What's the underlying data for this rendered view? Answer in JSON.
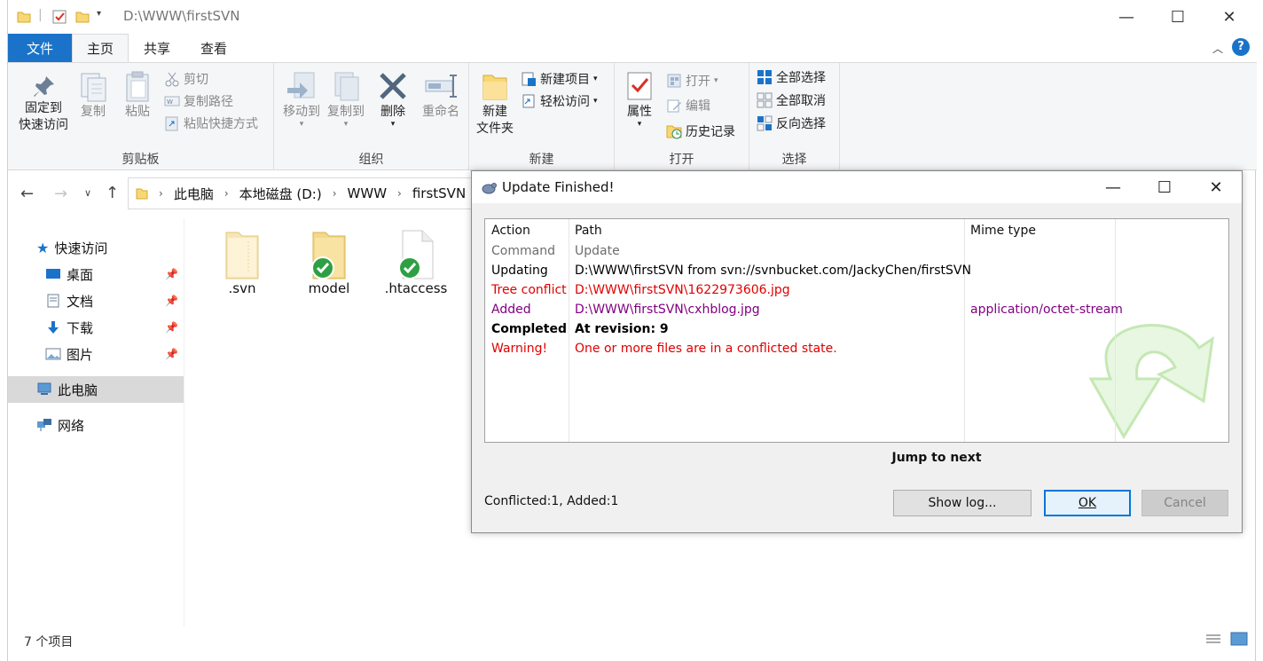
{
  "window": {
    "title": "D:\\WWW\\firstSVN"
  },
  "ribbon_tabs": [
    {
      "label": "文件"
    },
    {
      "label": "主页"
    },
    {
      "label": "共享"
    },
    {
      "label": "查看"
    }
  ],
  "ribbon": {
    "clipboard": {
      "label": "剪贴板",
      "pin": "固定到\n快速访问",
      "pin1": "固定到",
      "pin2": "快速访问",
      "copy": "复制",
      "paste": "粘贴",
      "cut": "剪切",
      "copy_path": "复制路径",
      "paste_shortcut": "粘贴快捷方式"
    },
    "organize": {
      "label": "组织",
      "move_to": "移动到",
      "copy_to": "复制到",
      "delete": "删除",
      "rename": "重命名"
    },
    "new": {
      "label": "新建",
      "new_folder1": "新建",
      "new_folder2": "文件夹",
      "new_item": "新建项目",
      "easy_access": "轻松访问"
    },
    "open": {
      "label": "打开",
      "properties": "属性",
      "open": "打开",
      "edit": "编辑",
      "history": "历史记录"
    },
    "select": {
      "label": "选择",
      "select_all": "全部选择",
      "select_none": "全部取消",
      "invert": "反向选择"
    }
  },
  "breadcrumb": [
    "此电脑",
    "本地磁盘 (D:)",
    "WWW",
    "firstSVN"
  ],
  "nav": {
    "quick_access": "快速访问",
    "desktop": "桌面",
    "documents": "文档",
    "downloads": "下载",
    "pictures": "图片",
    "this_pc": "此电脑",
    "network": "网络"
  },
  "files": [
    {
      "name": ".svn",
      "status": "none"
    },
    {
      "name": "model",
      "status": "normal"
    },
    {
      "name": ".htaccess",
      "status": "normal"
    }
  ],
  "status": {
    "item_count": "7 个项目"
  },
  "dialog": {
    "title": "Update Finished!",
    "columns": {
      "action": "Action",
      "path": "Path",
      "mime": "Mime type"
    },
    "rows": [
      {
        "action": "Command",
        "path": "Update",
        "mime": "",
        "color": "#6d6d6d",
        "bold": false
      },
      {
        "action": "Updating",
        "path": "D:\\WWW\\firstSVN from svn://svnbucket.com/JackyChen/firstSVN",
        "mime": "",
        "color": "#000000",
        "bold": false
      },
      {
        "action": "Tree conflict",
        "path": "D:\\WWW\\firstSVN\\1622973606.jpg",
        "mime": "",
        "color": "#e00000",
        "bold": false
      },
      {
        "action": "Added",
        "path": "D:\\WWW\\firstSVN\\cxhblog.jpg",
        "mime": "application/octet-stream",
        "color": "#800080",
        "bold": false
      },
      {
        "action": "Completed",
        "path": "At revision: 9",
        "mime": "",
        "color": "#000000",
        "bold": true
      },
      {
        "action": "Warning!",
        "path": "One or more files are in a conflicted state.",
        "mime": "",
        "color": "#e00000",
        "bold": false
      }
    ],
    "jump_label": "Jump to next",
    "summary": "Conflicted:1, Added:1",
    "buttons": {
      "show_log": "Show log...",
      "ok": "OK",
      "cancel": "Cancel"
    }
  }
}
